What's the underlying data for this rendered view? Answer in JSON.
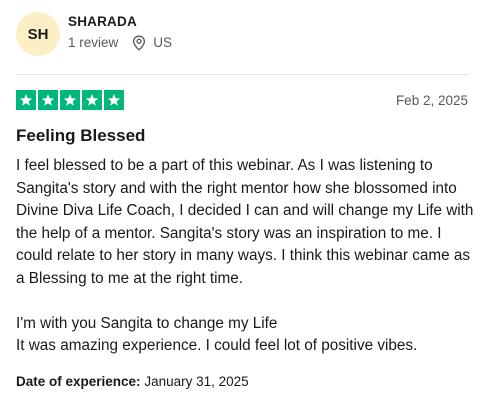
{
  "reviewer": {
    "initials": "SH",
    "name": "SHARADA",
    "review_count": "1 review",
    "country": "US"
  },
  "rating": {
    "stars": 5,
    "max_stars": 5,
    "star_color": "#00b67a",
    "date": "Feb 2, 2025"
  },
  "review": {
    "title": "Feeling Blessed",
    "paragraphs": [
      "I feel blessed to be a part of this webinar. As I was listening to Sangita's story and with the right mentor how she blossomed into Divine Diva Life Coach, I decided I can and will change my Life with the help of a mentor. Sangita's story was an inspiration to me. I could relate to her story in many ways. I think this webinar came as a Blessing to me at the right time.",
      "I'm with you Sangita to change my Life",
      "It was amazing experience. I could feel lot of positive vibes."
    ]
  },
  "experience": {
    "label": "Date of experience:",
    "date": "January 31, 2025"
  },
  "colors": {
    "avatar_bg": "#fcefc6",
    "text": "#191919",
    "muted": "#595959",
    "divider": "#e5e5dd"
  },
  "icons": {
    "location": "map-pin-icon",
    "star": "star-icon"
  }
}
